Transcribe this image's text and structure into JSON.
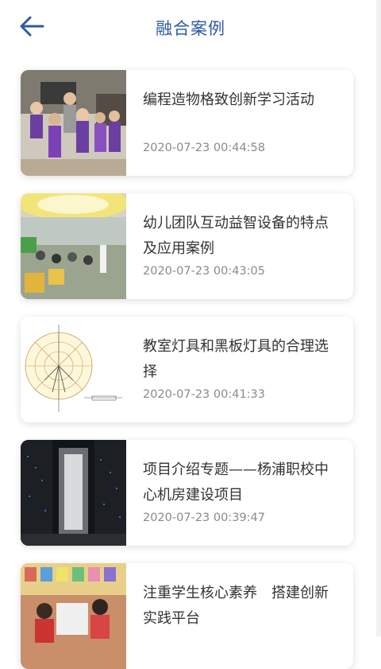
{
  "header": {
    "title": "融合案例",
    "back_icon": "back-arrow-icon",
    "accent_color": "#2d5aa3"
  },
  "cases": [
    {
      "title": "编程造物格致创新学习活动",
      "date": "2020-07-23 00:44:58"
    },
    {
      "title": "幼儿团队互动益智设备的特点及应用案例",
      "date": "2020-07-23 00:43:05"
    },
    {
      "title": "教室灯具和黑板灯具的合理选择",
      "date": "2020-07-23 00:41:33"
    },
    {
      "title": "项目介绍专题——杨浦职校中心机房建设项目",
      "date": "2020-07-23 00:39:47"
    },
    {
      "title": "注重学生核心素养　搭建创新实践平台",
      "date": ""
    }
  ]
}
